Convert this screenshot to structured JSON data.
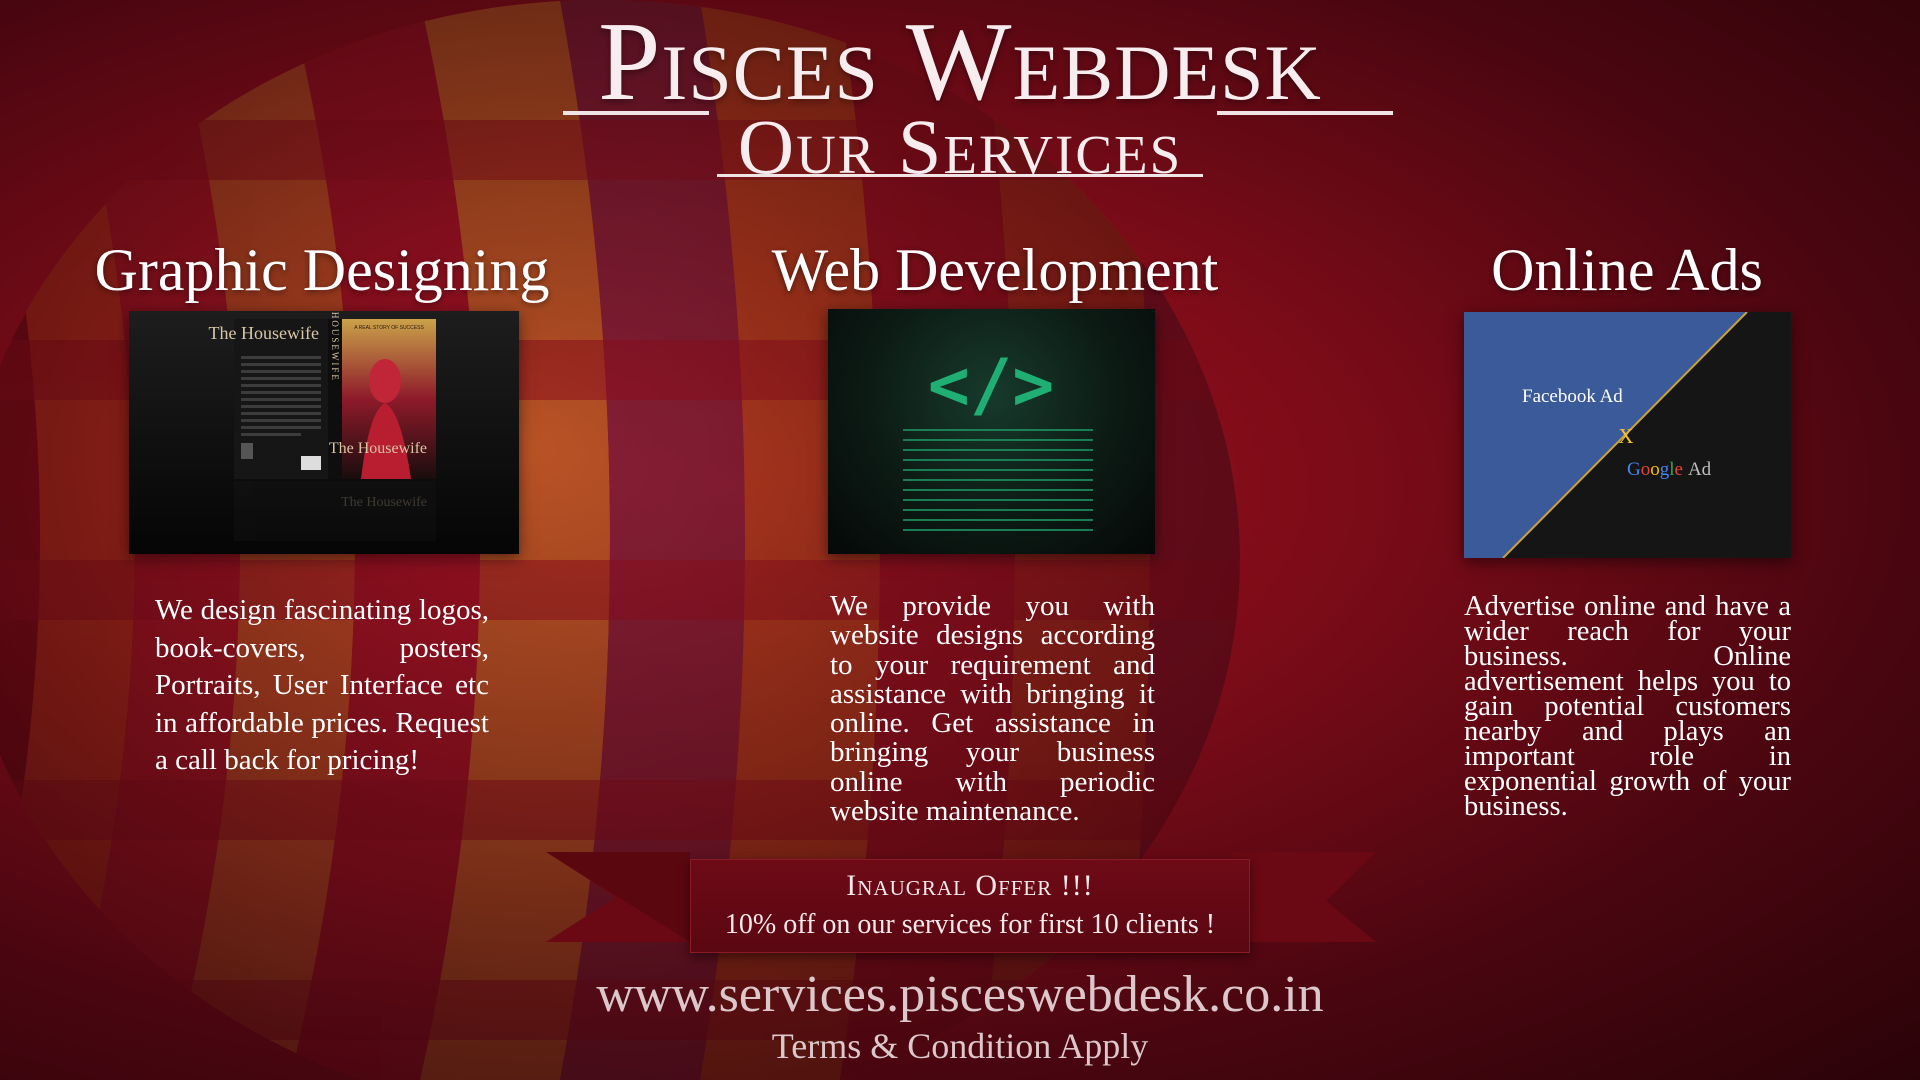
{
  "header": {
    "title": "Pisces Webdesk",
    "subtitle": "Our Services"
  },
  "services": [
    {
      "title": "Graphic Designing",
      "description": "We design fascinating logos, book-covers, posters, Portraits, User Interface etc in affordable prices. Request a call back for pricing!",
      "image": {
        "kind": "book-cover-mockup",
        "title_top": "The Housewife",
        "spine_text": "THE HOUSEWIFE",
        "tagline": "A REAL STORY OF SUCCESS",
        "title_bottom": "The Housewife",
        "title_reflection": "The Housewife"
      }
    },
    {
      "title": "Web Development",
      "description": "We provide you with website designs according to your requirement and assistance with bringing it online. Get assistance in bringing your business online with periodic website maintenance.",
      "image": {
        "kind": "code-tag-graphic",
        "code_symbol": "</>"
      }
    },
    {
      "title": "Online Ads",
      "description": "Advertise online and have a wider reach for your business. Online advertisement helps you to gain potential customers nearby and plays an important role in exponential growth of your business.",
      "image": {
        "kind": "ads-split-graphic",
        "facebook_label": "Facebook Ad",
        "separator": "X",
        "google_word": "Google",
        "google_suffix": "Ad"
      }
    }
  ],
  "offer": {
    "title": "Inaugral Offer !!!",
    "text": "10% off on our services for first 10 clients !"
  },
  "footer": {
    "website": "www.services.pisceswebdesk.co.in",
    "terms": "Terms & Condition Apply"
  },
  "colors": {
    "background": "#7e0c18",
    "ribbon": "#6e0a16",
    "facebook_blue": "#3b5a9a",
    "code_green": "#1fae74",
    "separator_gold": "#f0c230"
  }
}
